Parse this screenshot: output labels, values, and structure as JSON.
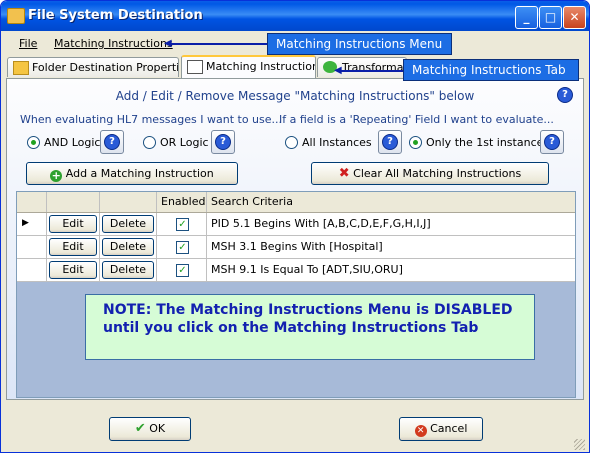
{
  "window": {
    "title": "File System Destination"
  },
  "menu": {
    "file": "File",
    "matching": "Matching Instructions"
  },
  "tabs": [
    "Folder Destination Properties",
    "Matching Instructions",
    "Transformatio"
  ],
  "header": "Add / Edit / Remove Message \"Matching Instructions\" below",
  "left_group": {
    "label": "When evaluating HL7 messages I want to use...",
    "and": "AND Logic",
    "or": "OR Logic"
  },
  "right_group": {
    "label": "If a field is a 'Repeating' Field I want to evaluate...",
    "all": "All Instances",
    "first": "Only the 1st instance"
  },
  "buttons": {
    "add": "Add a Matching Instruction",
    "clear": "Clear All Matching Instructions",
    "ok": "OK",
    "cancel": "Cancel",
    "edit": "Edit",
    "delete": "Delete"
  },
  "grid": {
    "columns": [
      "Enabled",
      "Search Criteria"
    ],
    "rows": [
      {
        "enabled": true,
        "criteria": "PID 5.1 Begins With [A,B,C,D,E,F,G,H,I,J]"
      },
      {
        "enabled": true,
        "criteria": "MSH 3.1 Begins With [Hospital]"
      },
      {
        "enabled": true,
        "criteria": "MSH 9.1 Is Equal To [ADT,SIU,ORU]"
      }
    ]
  },
  "callouts": {
    "menu": "Matching Instructions Menu",
    "tab": "Matching Instructions Tab"
  },
  "note": {
    "line1": "NOTE: The Matching Instructions Menu is DISABLED",
    "line2": "until you click on the Matching Instructions Tab"
  }
}
